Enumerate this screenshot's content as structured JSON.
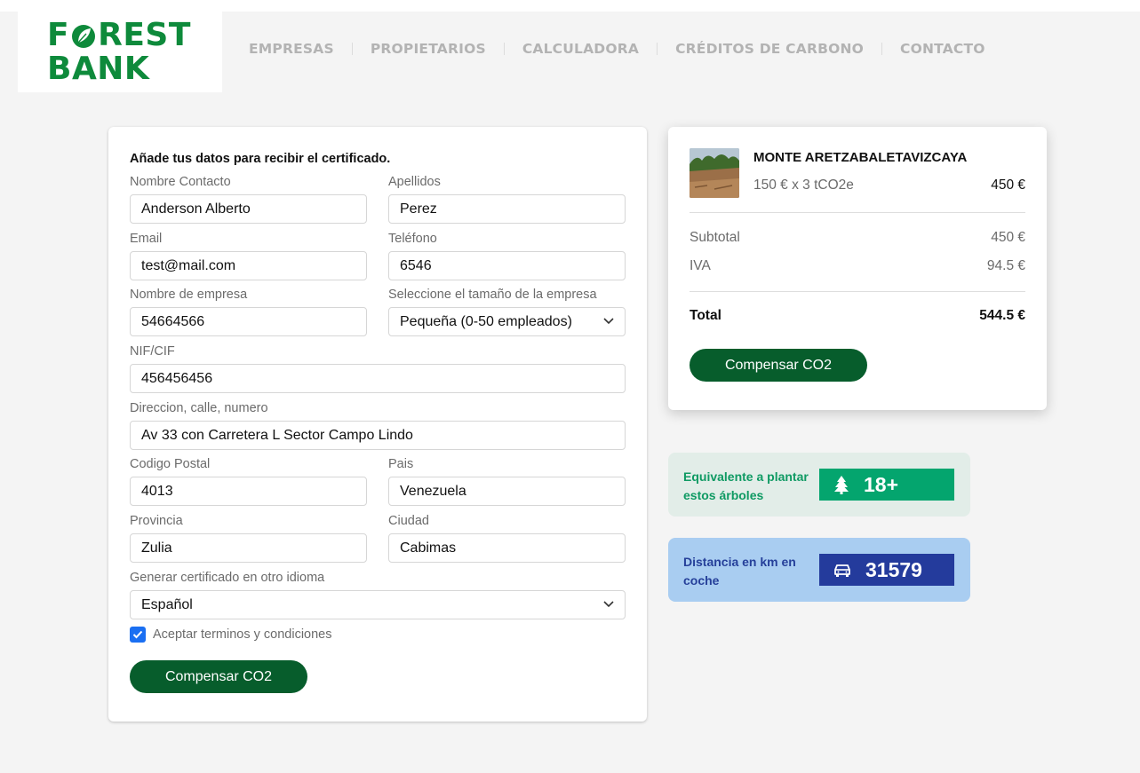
{
  "brand": {
    "line1_prefix": "F",
    "line1_suffix": "REST",
    "line2": "BANK",
    "color": "#0e8a3b"
  },
  "nav": {
    "items": [
      {
        "label": "EMPRESAS"
      },
      {
        "label": "PROPIETARIOS"
      },
      {
        "label": "CALCULADORA"
      },
      {
        "label": "CRÉDITOS DE CARBONO"
      },
      {
        "label": "CONTACTO"
      }
    ]
  },
  "form": {
    "title": "Añade tus datos para recibir el certificado.",
    "nombre": {
      "label": "Nombre Contacto",
      "value": "Anderson Alberto"
    },
    "apellidos": {
      "label": "Apellidos",
      "value": "Perez"
    },
    "email": {
      "label": "Email",
      "value": "test@mail.com"
    },
    "telefono": {
      "label": "Teléfono",
      "value": "6546"
    },
    "empresa": {
      "label": "Nombre de empresa",
      "value": "54664566"
    },
    "tamano": {
      "label": "Seleccione el tamaño de la empresa",
      "value": "Pequeña (0-50 empleados)"
    },
    "nif": {
      "label": "NIF/CIF",
      "value": "456456456"
    },
    "direccion": {
      "label": "Direccion, calle, numero",
      "value": "Av 33 con Carretera L Sector Campo Lindo"
    },
    "postal": {
      "label": "Codigo Postal",
      "value": "4013"
    },
    "pais": {
      "label": "Pais",
      "value": "Venezuela"
    },
    "provincia": {
      "label": "Provincia",
      "value": "Zulia"
    },
    "ciudad": {
      "label": "Ciudad",
      "value": "Cabimas"
    },
    "idioma": {
      "label": "Generar certificado en otro idioma",
      "value": "Español"
    },
    "terms": {
      "label": "Aceptar terminos y condiciones",
      "checked": true
    },
    "submit_label": "Compensar CO2"
  },
  "summary": {
    "product_name": "MONTE ARETZABALETAVIZCAYA",
    "product_qty": "150 € x 3 tCO2e",
    "product_price": "450 €",
    "subtotal_label": "Subtotal",
    "subtotal_value": "450 €",
    "iva_label": "IVA",
    "iva_value": "94.5 €",
    "total_label": "Total",
    "total_value": "544.5 €",
    "button_label": "Compensar CO2"
  },
  "stats": {
    "trees": {
      "label": "Equivalente a plantar estos árboles",
      "value": "18+",
      "icon": "tree-icon",
      "bg": "#e2ede8",
      "badge": "#04a56e",
      "text_color": "#0f9a63"
    },
    "distance": {
      "label": "Distancia en km en coche",
      "value": "31579",
      "icon": "car-icon",
      "bg": "#a9cdf1",
      "badge": "#243b9c",
      "text_color": "#26409a"
    }
  },
  "colors": {
    "primary_button": "#075d2c",
    "checkbox": "#1a6ff2",
    "nav_text": "#b3b3b3",
    "background": "#f4f4f4"
  }
}
